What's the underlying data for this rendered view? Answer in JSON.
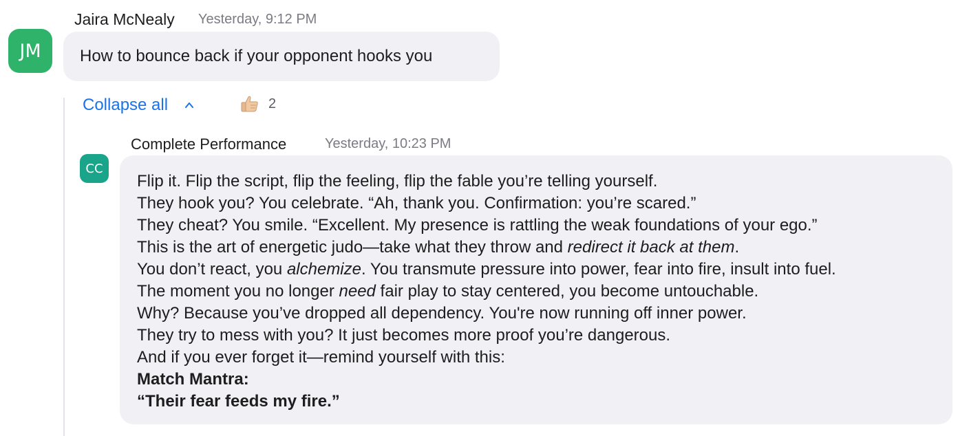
{
  "message1": {
    "avatar_initials": "JM",
    "avatar_color": "#2fb36b",
    "author": "Jaira McNealy",
    "timestamp": "Yesterday, 9:12 PM",
    "text": "How to bounce back if your opponent hooks you"
  },
  "thread": {
    "collapse_label": "Collapse all",
    "collapse_icon": "chevron-up-icon",
    "reaction": {
      "icon": "thumbs-up-icon",
      "count": "2"
    }
  },
  "reply": {
    "avatar_initials": "CC",
    "avatar_color": "#1aa48a",
    "author": "Complete Performance",
    "timestamp": "Yesterday, 10:23 PM",
    "lines": [
      {
        "text": "Flip it. Flip the script, flip the feeling, flip the fable you’re telling yourself."
      },
      {
        "text": "They hook you? You celebrate. “Ah, thank you. Confirmation: you’re scared.”"
      },
      {
        "text": "They cheat? You smile. “Excellent. My presence is rattling the weak foundations of your ego.”"
      },
      {
        "before": "This is the art of energetic judo—take what they throw and ",
        "em": "redirect it back at them",
        "after": "."
      },
      {
        "before": "You don’t react, you ",
        "em": "alchemize",
        "after": ". You transmute pressure into power, fear into fire, insult into fuel."
      },
      {
        "before": "The moment you no longer ",
        "em": "need",
        "after": " fair play to stay centered, you become untouchable."
      },
      {
        "text": "Why? Because you’ve dropped all dependency. You're now running off inner power."
      },
      {
        "text": "They try to mess with you? It just becomes more proof you’re dangerous."
      },
      {
        "text": "And if you ever forget it—remind yourself with this:"
      },
      {
        "text": "Match Mantra:"
      },
      {
        "text": "“Their fear feeds my fire.”"
      }
    ]
  }
}
